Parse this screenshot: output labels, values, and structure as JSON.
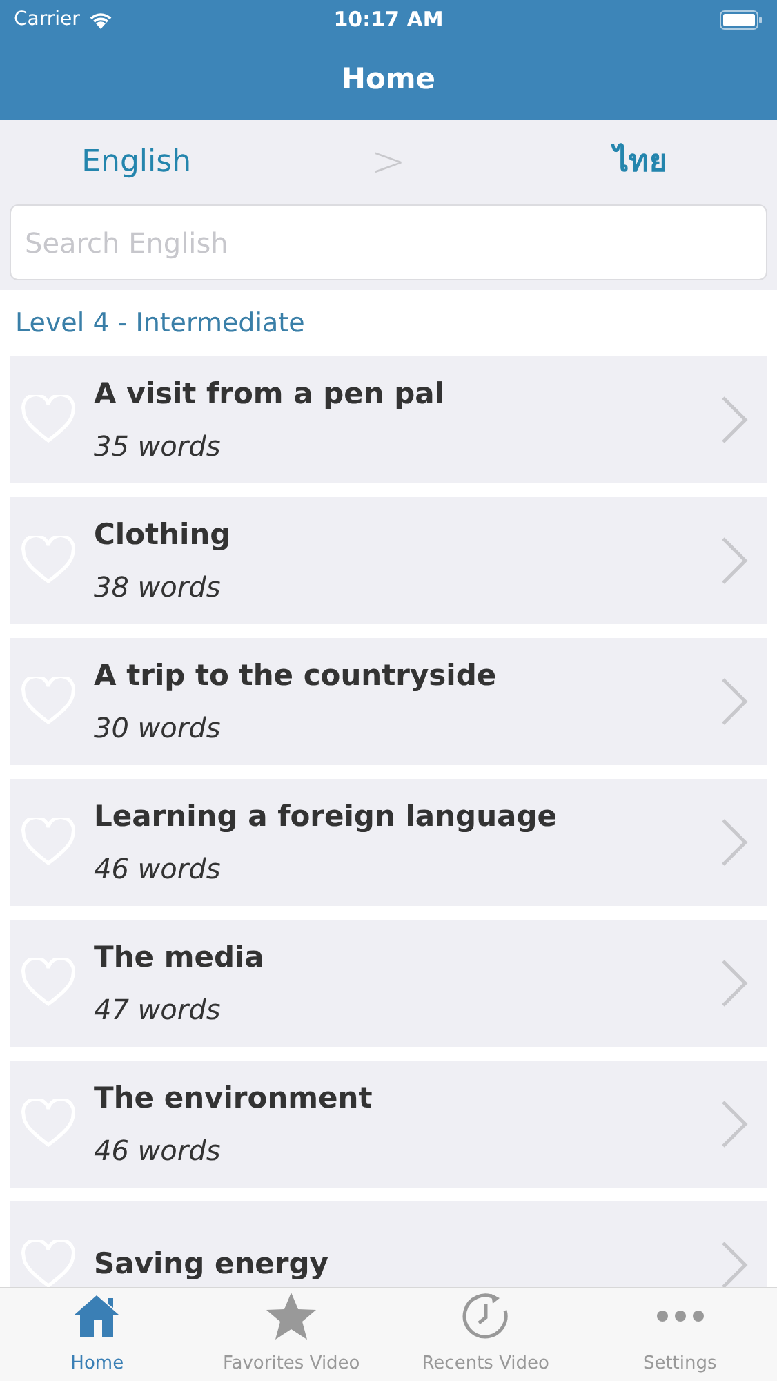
{
  "status_bar": {
    "carrier": "Carrier",
    "time": "10:17 AM"
  },
  "nav": {
    "title": "Home"
  },
  "languages": {
    "from": "English",
    "separator": ">",
    "to": "ไทย"
  },
  "search": {
    "placeholder": "Search English"
  },
  "section": {
    "title": "Level 4 - Intermediate"
  },
  "lessons": [
    {
      "title": "A visit from a pen pal",
      "count": "35 words",
      "favorite": false
    },
    {
      "title": "Clothing",
      "count": "38 words",
      "favorite": false
    },
    {
      "title": "A trip to the countryside",
      "count": "30 words",
      "favorite": false
    },
    {
      "title": "Learning a foreign language",
      "count": "46 words",
      "favorite": false
    },
    {
      "title": "The media",
      "count": "47 words",
      "favorite": false
    },
    {
      "title": "The environment",
      "count": "46 words",
      "favorite": false
    },
    {
      "title": "Saving energy",
      "favorite": false
    }
  ],
  "tabs": [
    {
      "kind": "home",
      "label": "Home",
      "selected": true
    },
    {
      "kind": "star",
      "label": "Favorites Video",
      "selected": false
    },
    {
      "kind": "clock",
      "label": "Recents Video",
      "selected": false
    },
    {
      "kind": "more",
      "label": "Settings",
      "selected": false
    }
  ]
}
